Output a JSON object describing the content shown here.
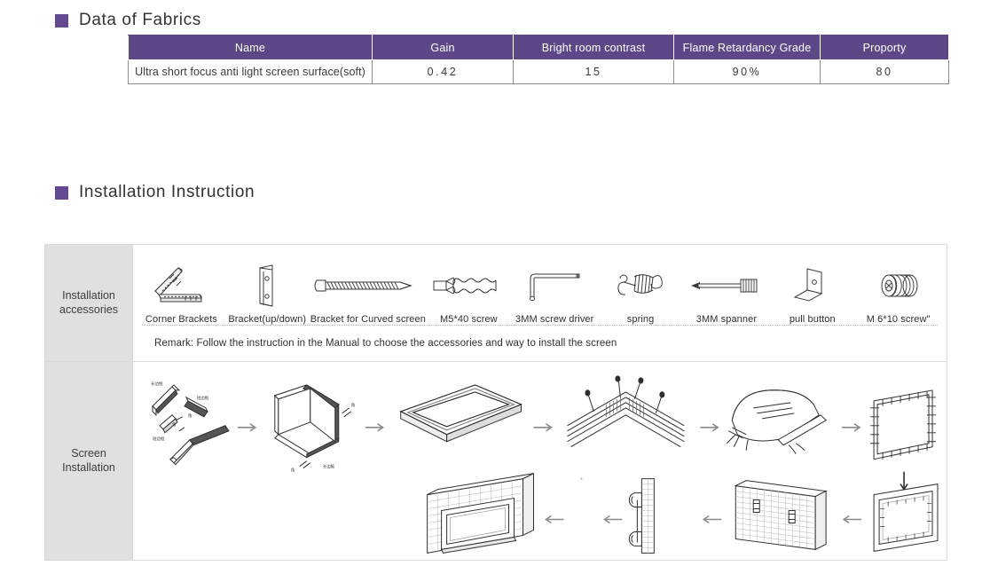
{
  "sections": {
    "fabrics": {
      "bullet_color": "#63498f",
      "title": "Data of Fabrics"
    },
    "installation": {
      "bullet_color": "#63498f",
      "title": "Installation Instruction"
    }
  },
  "fabrics_table": {
    "header_bg": "#5d4787",
    "columns": [
      "Name",
      "Gain",
      "Bright room contrast",
      "Flame Retardancy Grade",
      "Proporty"
    ],
    "rows": [
      {
        "name": "Ultra short focus anti light screen surface(soft)",
        "gain": "0.42",
        "bright_room_contrast": "15",
        "flame_retardancy_grade": "90%",
        "proporty": "80"
      }
    ]
  },
  "installation_block": {
    "rows": {
      "accessories_label": "Installation\naccessories",
      "screen_label": "Screen\nInstallation"
    },
    "accessories": [
      {
        "icon": "corner-bracket-icon",
        "label": "Corner Brackets"
      },
      {
        "icon": "plate-bracket-icon",
        "label": "Bracket(up/down)"
      },
      {
        "icon": "long-screw-icon",
        "label": "Bracket for Curved screen"
      },
      {
        "icon": "wall-anchor-icon",
        "label": "M5*40 screw"
      },
      {
        "icon": "hex-key-icon",
        "label": "3MM screw driver"
      },
      {
        "icon": "spring-icon",
        "label": "spring"
      },
      {
        "icon": "spanner-icon",
        "label": "3MM spanner"
      },
      {
        "icon": "angle-bracket-icon",
        "label": "pull button"
      },
      {
        "icon": "threaded-bolt-icon",
        "label": "M 6*10 screw\""
      }
    ],
    "remark": "Remark: Follow the instruction in the Manual to choose the  accessories and way to install the screen",
    "screen_steps": [
      {
        "step": 1,
        "name": "frame-pieces-exploded",
        "annotations": [
          "长边框",
          "短边框",
          "短边框",
          "角",
          "角"
        ]
      },
      {
        "step": 2,
        "name": "frame-assembled-square",
        "annotations": [
          "角",
          "角",
          "长边框"
        ]
      },
      {
        "step": 3,
        "name": "frame-rectangle-complete",
        "annotations": []
      },
      {
        "step": 4,
        "name": "frame-corner-with-pins",
        "annotations": []
      },
      {
        "step": 5,
        "name": "fabric-over-frame",
        "annotations": []
      },
      {
        "step": 6,
        "name": "fabric-tensioned-frame",
        "annotations": []
      },
      {
        "step": 7,
        "name": "screen-back-with-clips",
        "annotations": []
      },
      {
        "step": 8,
        "name": "wall-with-mount-brackets",
        "annotations": []
      },
      {
        "step": 9,
        "name": "wall-section-side-view",
        "annotations": []
      },
      {
        "step": 10,
        "name": "screen-mounted-on-wall",
        "annotations": []
      }
    ]
  }
}
